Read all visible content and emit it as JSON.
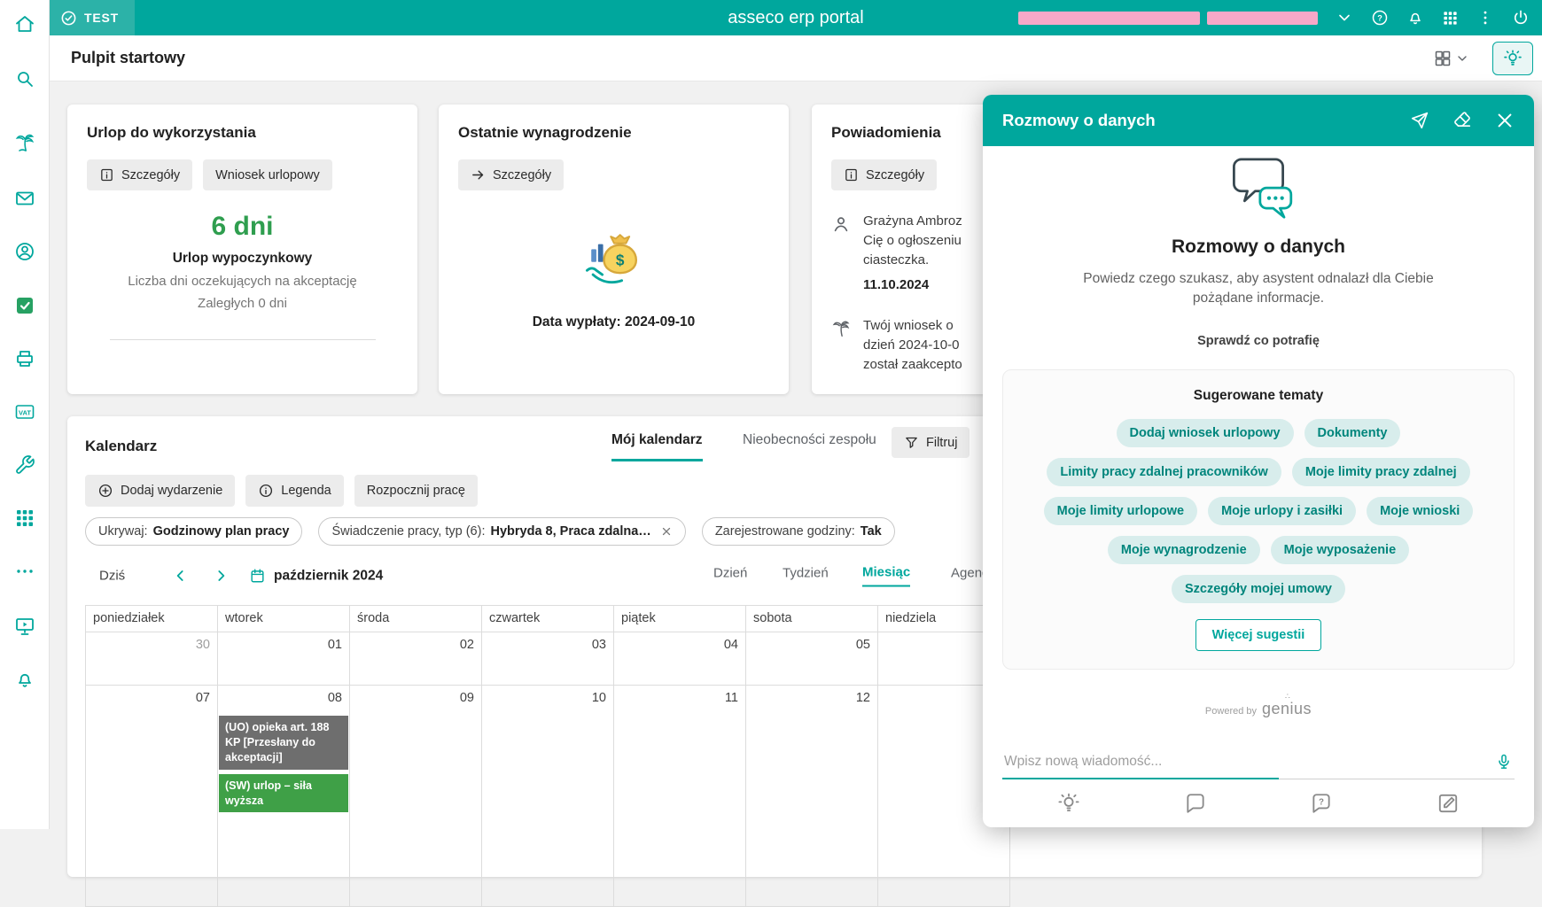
{
  "colors": {
    "teal": "#00a79d",
    "green_accent": "#2f9e4f",
    "event_gray": "#6e6e6e",
    "event_green": "#3fa047",
    "chip_bg": "#d8edec",
    "chip_text": "#00857c",
    "redaction_pink": "#f7a8c8"
  },
  "sidebar": {
    "icons": [
      "home-icon",
      "search-icon",
      "vacation-palm-icon",
      "mail-icon",
      "contacts-icon",
      "tasks-check-icon",
      "printer-icon",
      "vat-icon",
      "tools-icon",
      "apps-grid-icon",
      "more-icon",
      "presentation-icon",
      "notifications-bell-icon"
    ]
  },
  "topbar": {
    "badge": "TEST",
    "title": "asseco erp portal",
    "icons": [
      "chevron-down-icon",
      "help-icon",
      "bell-icon",
      "apps-grid-icon",
      "kebab-menu-icon",
      "power-icon"
    ]
  },
  "header": {
    "title": "Pulpit startowy"
  },
  "cards": {
    "vacation": {
      "title": "Urlop do wykorzystania",
      "details": "Szczegóły",
      "request": "Wniosek urlopowy",
      "days": "6 dni",
      "type": "Urlop wypoczynkowy",
      "pending": "Liczba dni oczekujących na akceptację",
      "overdue": "Zaległych 0 dni"
    },
    "salary": {
      "title": "Ostatnie wynagrodzenie",
      "details": "Szczegóły",
      "payout": "Data wypłaty: 2024-09-10"
    },
    "notifications": {
      "title": "Powiadomienia",
      "details": "Szczegóły",
      "items": [
        {
          "line1": "Grażyna Ambroz",
          "line2": "Cię o ogłoszeniu",
          "line3": "ciasteczka.",
          "date": "11.10.2024"
        },
        {
          "line1": "Twój wniosek o",
          "line2": "dzień 2024-10-0",
          "line3": "został zaakcepto",
          "date": ""
        }
      ]
    }
  },
  "calendar": {
    "title": "Kalendarz",
    "tab_my": "Mój kalendarz",
    "tab_team": "Nieobecności zespołu",
    "filter": "Filtruj",
    "add_event": "Dodaj wydarzenie",
    "legend": "Legenda",
    "start_work": "Rozpocznij pracę",
    "chip1_label": "Ukrywaj:",
    "chip1_value": "Godzinowy plan pracy",
    "chip2_label": "Świadczenie pracy, typ (6):",
    "chip2_value": "Hybryda 8, Praca zdalna…",
    "chip3_label": "Zarejestrowane godziny:",
    "chip3_value": "Tak",
    "today": "Dziś",
    "month_label": "październik 2024",
    "view_day": "Dzień",
    "view_week": "Tydzień",
    "view_month": "Miesiąc",
    "view_agenda": "Agenda",
    "active_view": "Miesiąc",
    "weekdays": [
      "poniedziałek",
      "wtorek",
      "środa",
      "czwartek",
      "piątek",
      "sobota",
      "niedziela"
    ],
    "weeks": [
      {
        "d0": "30",
        "d1": "01",
        "d2": "02",
        "d3": "03",
        "d4": "04",
        "d5": "05",
        "d6": ""
      },
      {
        "d0": "07",
        "d1": "08",
        "d2": "09",
        "d3": "10",
        "d4": "11",
        "d5": "12",
        "d6": ""
      }
    ],
    "events": [
      {
        "text": "(UO) opieka art. 188 KP [Przesłany do akceptacji]",
        "type": "gray"
      },
      {
        "text": "(SW) urlop – siła wyższa",
        "type": "green"
      }
    ]
  },
  "chat": {
    "header": "Rozmowy o danych",
    "header_icons": [
      "send-off-icon",
      "eraser-icon",
      "close-icon"
    ],
    "heading": "Rozmowy o danych",
    "description": "Powiedz czego szukasz, aby asystent odnalazł dla Ciebie pożądane informacje.",
    "check": "Sprawdź co potrafię",
    "topics_title": "Sugerowane tematy",
    "topics": [
      "Dodaj wniosek urlopowy",
      "Dokumenty",
      "Limity pracy zdalnej pracowników",
      "Moje limity pracy zdalnej",
      "Moje limity urlopowe",
      "Moje urlopy i zasiłki",
      "Moje wnioski",
      "Moje wynagrodzenie",
      "Moje wyposażenie",
      "Szczegóły mojej umowy"
    ],
    "more": "Więcej sugestii",
    "powered_by": "Powered by",
    "brand": "genius",
    "placeholder": "Wpisz nową wiadomość...",
    "toolbar_icons": [
      "lightbulb-icon",
      "chat-bubble-icon",
      "chat-question-icon",
      "compose-icon"
    ]
  }
}
